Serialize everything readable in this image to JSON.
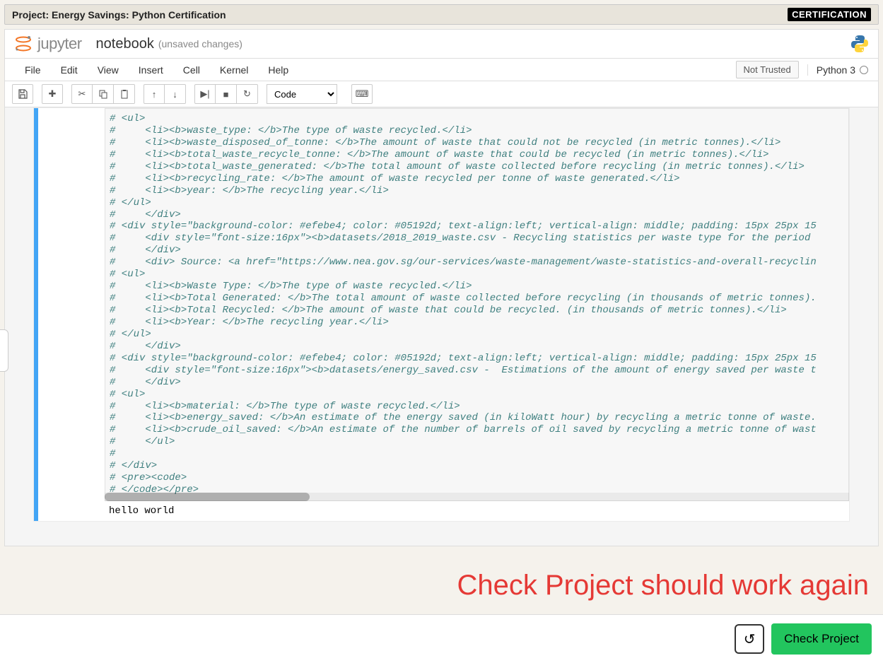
{
  "top_bar": {
    "title": "Project: Energy Savings: Python Certification",
    "badge": "CERTIFICATION"
  },
  "header": {
    "logo_text": "jupyter",
    "notebook_name": "notebook",
    "save_status": "(unsaved changes)"
  },
  "menu": {
    "file": "File",
    "edit": "Edit",
    "view": "View",
    "insert": "Insert",
    "cell": "Cell",
    "kernel": "Kernel",
    "help": "Help",
    "trust": "Not Trusted",
    "kernel_name": "Python 3"
  },
  "toolbar": {
    "cell_type": "Code"
  },
  "cell": {
    "code_lines": [
      "# <ul>",
      "#     <li><b>waste_type: </b>The type of waste recycled.</li>",
      "#     <li><b>waste_disposed_of_tonne: </b>The amount of waste that could not be recycled (in metric tonnes).</li>",
      "#     <li><b>total_waste_recycle_tonne: </b>The amount of waste that could be recycled (in metric tonnes).</li>",
      "#     <li><b>total_waste_generated: </b>The total amount of waste collected before recycling (in metric tonnes).</li>",
      "#     <li><b>recycling_rate: </b>The amount of waste recycled per tonne of waste generated.</li>",
      "#     <li><b>year: </b>The recycling year.</li>",
      "# </ul>",
      "#     </div>",
      "# <div style=\"background-color: #efebe4; color: #05192d; text-align:left; vertical-align: middle; padding: 15px 25px 15",
      "#     <div style=\"font-size:16px\"><b>datasets/2018_2019_waste.csv - Recycling statistics per waste type for the period ",
      "#     </div>",
      "#     <div> Source: <a href=\"https://www.nea.gov.sg/our-services/waste-management/waste-statistics-and-overall-recyclin",
      "# <ul>",
      "#     <li><b>Waste Type: </b>The type of waste recycled.</li>",
      "#     <li><b>Total Generated: </b>The total amount of waste collected before recycling (in thousands of metric tonnes).",
      "#     <li><b>Total Recycled: </b>The amount of waste that could be recycled. (in thousands of metric tonnes).</li>",
      "#     <li><b>Year: </b>The recycling year.</li>",
      "# </ul>",
      "#     </div>",
      "# <div style=\"background-color: #efebe4; color: #05192d; text-align:left; vertical-align: middle; padding: 15px 25px 15",
      "#     <div style=\"font-size:16px\"><b>datasets/energy_saved.csv -  Estimations of the amount of energy saved per waste t",
      "#     </div>",
      "# <ul>",
      "#     <li><b>material: </b>The type of waste recycled.</li>",
      "#     <li><b>energy_saved: </b>An estimate of the energy saved (in kiloWatt hour) by recycling a metric tonne of waste.",
      "#     <li><b>crude_oil_saved: </b>An estimate of the number of barrels of oil saved by recycling a metric tonne of wast",
      "#     </ul>",
      "# ",
      "# </div>",
      "# <pre><code>",
      "# </code></pre>"
    ],
    "output": "hello world"
  },
  "annotation": "Check Project should work again",
  "footer": {
    "check_label": "Check Project"
  }
}
